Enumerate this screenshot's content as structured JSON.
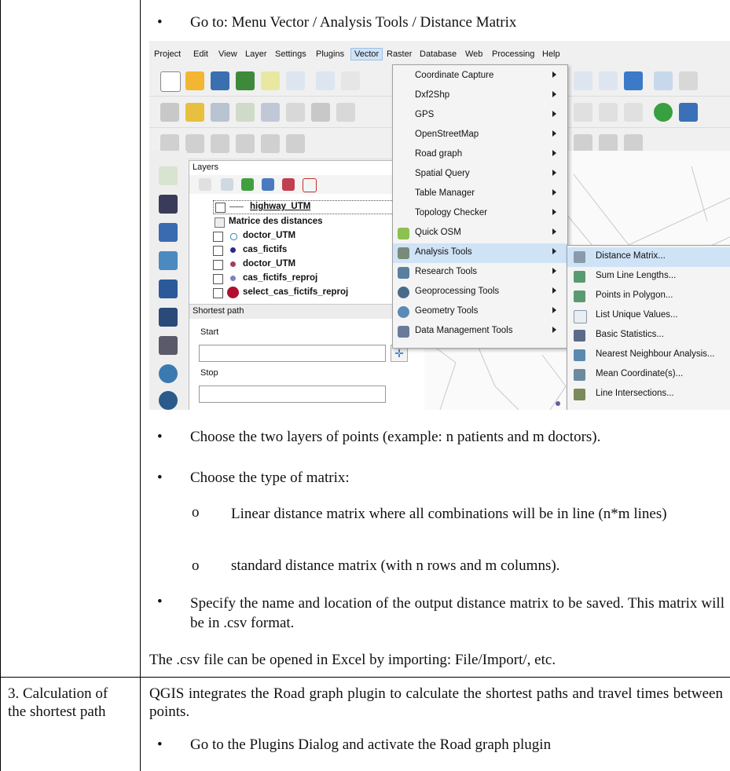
{
  "intro_bullet": "Go to: Menu Vector / Analysis Tools / Distance Matrix",
  "screenshot": {
    "menubar": [
      "Project",
      "Edit",
      "View",
      "Layer",
      "Settings",
      "Plugins",
      "Vector",
      "Raster",
      "Database",
      "Web",
      "Processing",
      "Help"
    ],
    "layers_panel": {
      "title": "Layers",
      "items": [
        {
          "name": "highway_UTM",
          "checked": true,
          "symbol": "line"
        },
        {
          "name": "Matrice des distances",
          "checked": null,
          "symbol": "table"
        },
        {
          "name": "doctor_UTM",
          "checked": false,
          "symbol": "#5fb0d8"
        },
        {
          "name": "cas_fictifs",
          "checked": false,
          "symbol": "#2b2b8c"
        },
        {
          "name": "doctor_UTM",
          "checked": false,
          "symbol": "#a04060"
        },
        {
          "name": "cas_fictifs_reproj",
          "checked": true,
          "symbol": "#8080c0"
        },
        {
          "name": "select_cas_fictifs_reproj",
          "checked": false,
          "symbol": "#b01030"
        }
      ]
    },
    "shortest_path": {
      "title": "Shortest path",
      "start_label": "Start",
      "stop_label": "Stop"
    },
    "vector_menu": [
      {
        "label": "Coordinate Capture",
        "sub": true
      },
      {
        "label": "Dxf2Shp",
        "sub": true
      },
      {
        "label": "GPS",
        "sub": true
      },
      {
        "label": "OpenStreetMap",
        "sub": true
      },
      {
        "label": "Road graph",
        "sub": true
      },
      {
        "label": "Spatial Query",
        "sub": true
      },
      {
        "label": "Table Manager",
        "sub": true
      },
      {
        "label": "Topology Checker",
        "sub": true
      },
      {
        "label": "Quick OSM",
        "sub": true
      },
      {
        "label": "Analysis Tools",
        "sub": true,
        "selected": true
      },
      {
        "label": "Research Tools",
        "sub": true
      },
      {
        "label": "Geoprocessing Tools",
        "sub": true
      },
      {
        "label": "Geometry Tools",
        "sub": true
      },
      {
        "label": "Data Management Tools",
        "sub": true
      }
    ],
    "analysis_submenu": [
      {
        "label": "Distance Matrix...",
        "selected": true
      },
      {
        "label": "Sum Line Lengths..."
      },
      {
        "label": "Points in Polygon..."
      },
      {
        "label": "List Unique Values..."
      },
      {
        "label": "Basic Statistics..."
      },
      {
        "label": "Nearest Neighbour Analysis..."
      },
      {
        "label": "Mean Coordinate(s)..."
      },
      {
        "label": "Line Intersections..."
      }
    ]
  },
  "bullets": [
    "Choose the two layers of points (example: n patients and m doctors).",
    "Choose the type of matrix:"
  ],
  "sub_bullets": [
    "Linear distance matrix where all combinations will be in line (n*m lines)",
    "standard distance matrix (with n rows and m columns)."
  ],
  "bullet_specify": "Specify the name and location of the output distance matrix to be saved. This matrix will be in .csv format.",
  "csv_note": "The .csv file can be opened in Excel by importing: File/Import/, etc.",
  "row3": {
    "step_label": "3. Calculation of the shortest path",
    "paragraph": "QGIS integrates the Road graph plugin to calculate the shortest paths and travel times between points.",
    "bullet": "Go to the Plugins Dialog and activate the Road graph plugin"
  }
}
